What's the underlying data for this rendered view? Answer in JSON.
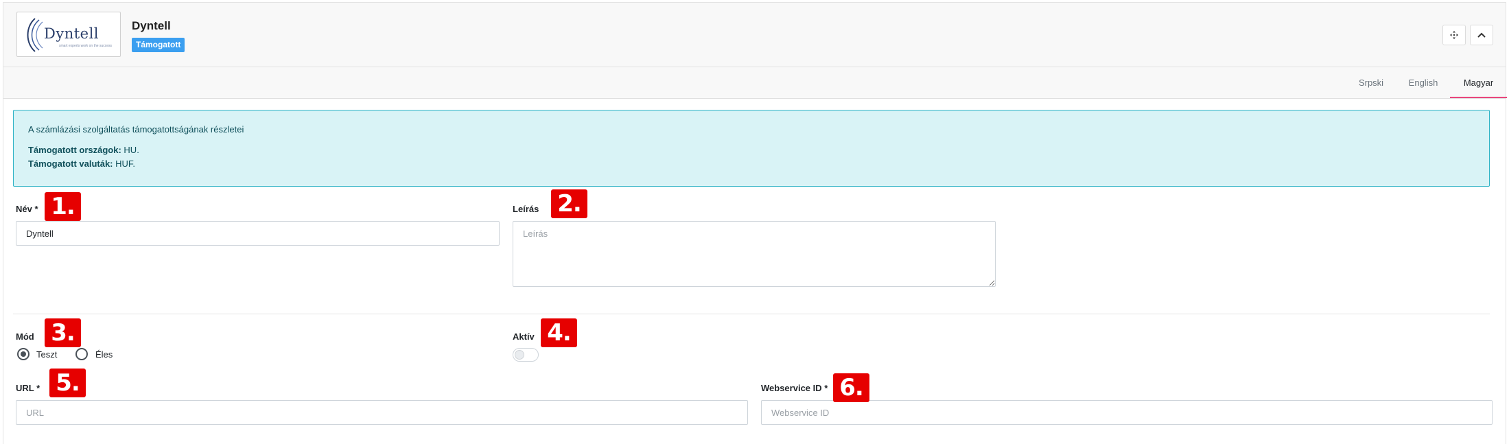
{
  "header": {
    "logo_text": "Dyntell",
    "logo_tagline": "smart experts work on the success",
    "vendor_name": "Dyntell",
    "badge": "Támogatott",
    "move_icon": "move-icon",
    "collapse_icon": "chevron-up-icon"
  },
  "tabs": [
    {
      "label": "Srpski",
      "active": false
    },
    {
      "label": "English",
      "active": false
    },
    {
      "label": "Magyar",
      "active": true
    }
  ],
  "alert": {
    "title": "A számlázási szolgáltatás támogatottságának részletei",
    "countries_label": "Támogatott országok:",
    "countries_value": "HU.",
    "currencies_label": "Támogatott valuták:",
    "currencies_value": "HUF."
  },
  "form": {
    "name_label": "Név *",
    "name_value": "Dyntell",
    "description_label": "Leírás",
    "description_placeholder": "Leírás",
    "mode_label": "Mód",
    "mode_options": [
      {
        "label": "Teszt",
        "checked": true
      },
      {
        "label": "Éles",
        "checked": false
      }
    ],
    "active_label": "Aktív",
    "active_value": false,
    "url_label": "URL *",
    "url_placeholder": "URL",
    "webservice_label": "Webservice ID *",
    "webservice_placeholder": "Webservice ID"
  },
  "markers": [
    "1.",
    "2.",
    "3.",
    "4.",
    "5.",
    "6."
  ],
  "colors": {
    "badge": "#3b9ff0",
    "tab_active_underline": "#e8467c",
    "alert_bg": "#d9f3f6",
    "alert_border": "#2fb3c6",
    "marker": "#e60000"
  }
}
